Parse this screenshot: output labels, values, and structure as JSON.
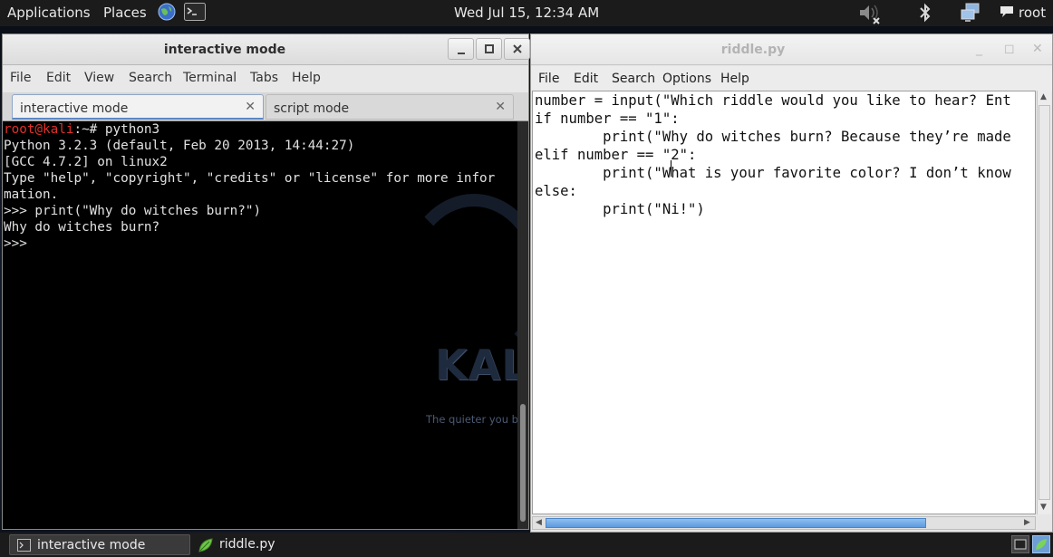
{
  "top_panel": {
    "applications": "Applications",
    "places": "Places",
    "clock": "Wed Jul 15, 12:34 AM",
    "user": "root"
  },
  "terminal": {
    "title": "interactive mode",
    "menu": [
      "File",
      "Edit",
      "View",
      "Search",
      "Terminal",
      "Tabs",
      "Help"
    ],
    "tabs": [
      {
        "label": "interactive mode",
        "active": true
      },
      {
        "label": "script mode",
        "active": false
      }
    ],
    "prompt_user": "root@kali",
    "prompt_rest": ":~# python3",
    "lines": [
      "Python 3.2.3 (default, Feb 20 2013, 14:44:27)",
      "[GCC 4.7.2] on linux2",
      "Type \"help\", \"copyright\", \"credits\" or \"license\" for more infor",
      "mation.",
      ">>> print(\"Why do witches burn?\")",
      "Why do witches burn?",
      ">>> "
    ],
    "watermark": "KALI",
    "tagline": "The quieter you become"
  },
  "editor": {
    "title": "riddle.py",
    "menu": [
      "File",
      "Edit",
      "Search",
      "Options",
      "Help"
    ],
    "code_lines": [
      "number = input(\"Which riddle would you like to hear? Ent",
      "if number == \"1\":",
      "        print(\"Why do witches burn? Because they’re made",
      "elif number == \"2\":",
      "        print(\"What is your favorite color? I don’t know",
      "else:",
      "        print(\"Ni!\")"
    ]
  },
  "taskbar": {
    "tasks": [
      "interactive mode",
      "riddle.py"
    ]
  }
}
